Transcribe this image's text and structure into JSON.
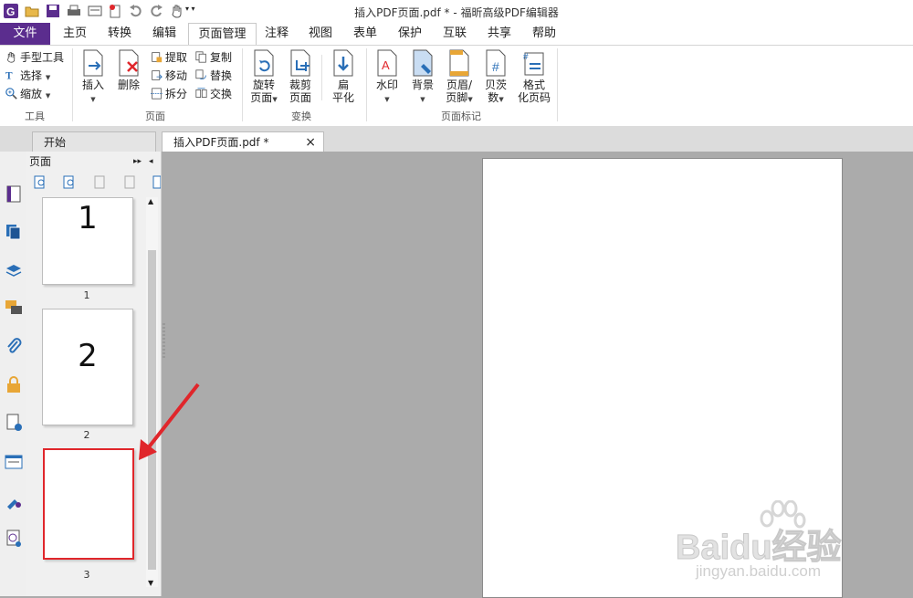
{
  "window": {
    "title": "插入PDF页面.pdf * - 福昕高级PDF编辑器"
  },
  "menu": {
    "tabs": [
      "文件",
      "主页",
      "转换",
      "编辑",
      "页面管理",
      "注释",
      "视图",
      "表单",
      "保护",
      "互联",
      "共享",
      "帮助"
    ],
    "active": "页面管理"
  },
  "ribbon": {
    "tools": {
      "label": "工具",
      "hand": "手型工具",
      "select": "选择",
      "zoom": "缩放"
    },
    "pages": {
      "label": "页面",
      "insert": "插入",
      "delete": "删除",
      "extract": "提取",
      "copy": "复制",
      "move": "移动",
      "replace": "替换",
      "split": "拆分",
      "swap": "交换"
    },
    "transform": {
      "label": "变换",
      "rotate_1": "旋转",
      "rotate_2": "页面",
      "crop_1": "裁剪",
      "crop_2": "页面",
      "flatten_1": "扁",
      "flatten_2": "平化"
    },
    "marks": {
      "label": "页面标记",
      "watermark": "水印",
      "background_1": "背景",
      "header_1": "页眉/",
      "header_2": "页脚",
      "bates_1": "贝茨",
      "bates_2": "数",
      "format_1": "格式",
      "format_2": "化页码"
    }
  },
  "doc_tabs": {
    "start": "开始",
    "file": "插入PDF页面.pdf *",
    "close": "×"
  },
  "panel": {
    "title": "页面",
    "thumbnails": [
      {
        "content": "1",
        "label": "1"
      },
      {
        "content": "2",
        "label": "2"
      },
      {
        "content": "",
        "label": "3"
      }
    ]
  },
  "colors": {
    "file_tab": "#5b2d8e",
    "highlight": "#e0262b",
    "arrow": "#e0262b"
  },
  "watermark": {
    "brand": "Baidu经验",
    "url": "jingyan.baidu.com"
  }
}
